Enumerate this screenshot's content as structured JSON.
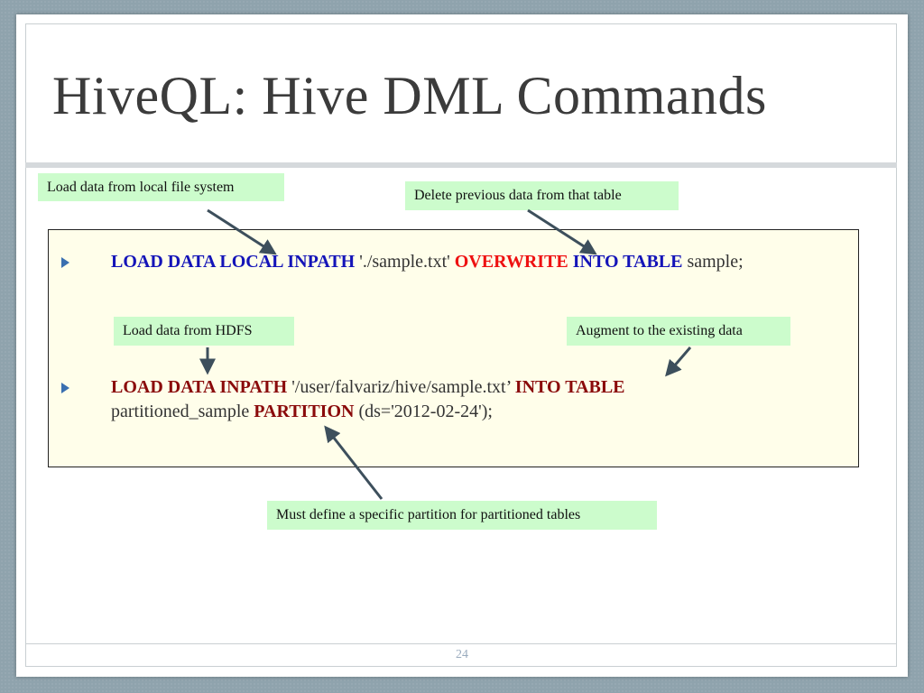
{
  "slide": {
    "title": "HiveQL: Hive DML Commands",
    "page_number": "24"
  },
  "callouts": {
    "local": "Load data from local file system",
    "delete": "Delete previous data from that table",
    "hdfs": "Load data from HDFS",
    "augment": "Augment to the existing data",
    "partition": "Must define a specific partition for partitioned tables"
  },
  "code": {
    "line1": {
      "kw1": "LOAD DATA LOCAL INPATH",
      "path": " './sample.txt' ",
      "kw2": "OVERWRITE",
      "kw3": " INTO TABLE",
      "rest": " sample;"
    },
    "line2": {
      "kw1": "LOAD DATA INPATH",
      "path": " '/user/falvariz/hive/sample.txt’ ",
      "kw2": "INTO TABLE"
    },
    "line3": {
      "table": "partitioned_sample ",
      "kw": "PARTITION",
      "rest": " (ds='2012-02-24');"
    }
  },
  "colors": {
    "keyword_blue": "#1414b8",
    "keyword_red": "#ee1111",
    "keyword_dark_red": "#8a0a0a",
    "callout_bg": "#ccfccc",
    "code_bg": "#fffeea",
    "bullet": "#3a6fb0",
    "arrow": "#3d4f5c"
  }
}
